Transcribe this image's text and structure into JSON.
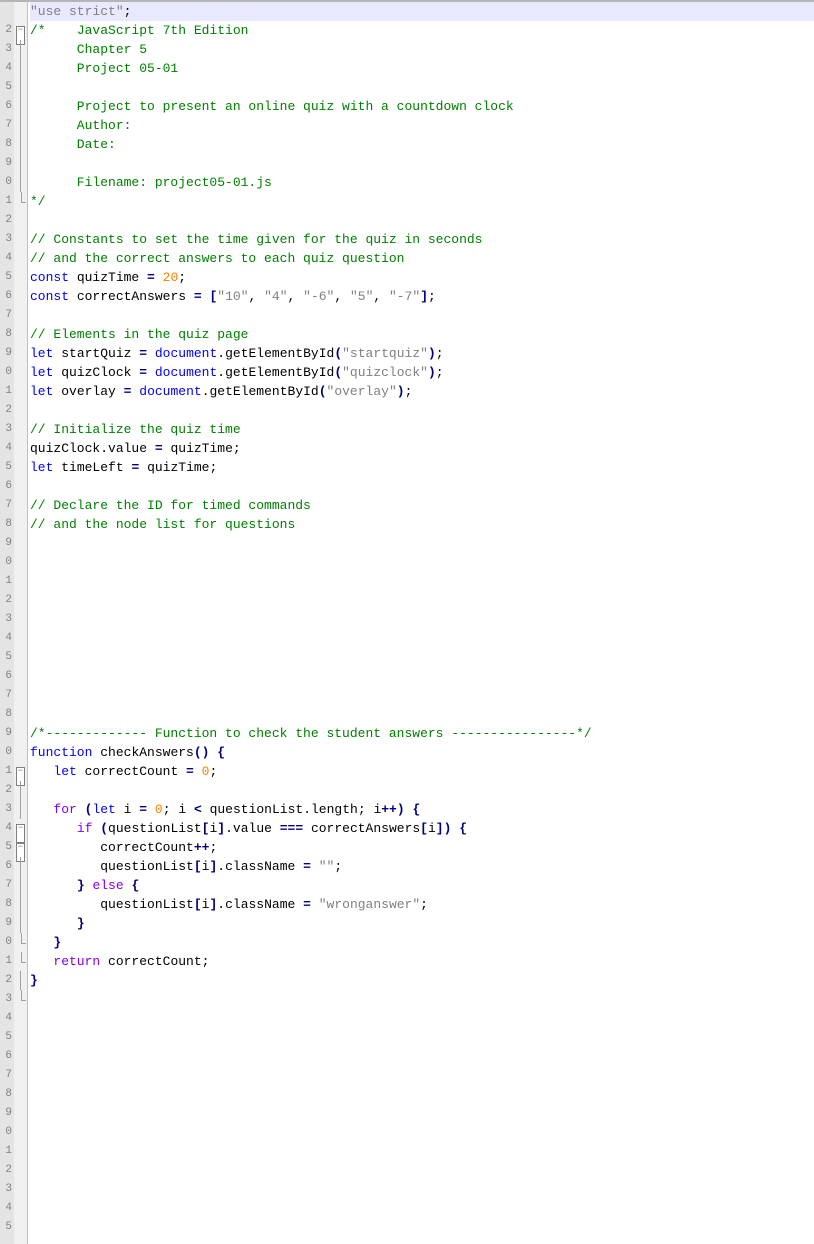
{
  "lineNumbers": [
    "",
    "2",
    "3",
    "4",
    "5",
    "6",
    "7",
    "8",
    "9",
    "0",
    "1",
    "2",
    "3",
    "4",
    "5",
    "6",
    "7",
    "8",
    "9",
    "0",
    "1",
    "2",
    "3",
    "4",
    "5",
    "6",
    "7",
    "8",
    "9",
    "0",
    "1",
    "2",
    "3",
    "4",
    "5",
    "6",
    "7",
    "8",
    "9",
    "0",
    "1",
    "2",
    "3",
    "4",
    "5",
    "6",
    "7",
    "8",
    "9",
    "0",
    "1",
    "2",
    "3",
    "4",
    "5",
    "6",
    "7",
    "8",
    "9",
    "0",
    "1",
    "2",
    "3",
    "4",
    "5"
  ],
  "fold": {
    "boxMinus": "−",
    "blockStart": 1,
    "blockEnd": 10,
    "funcStart": 40,
    "forStart": 43,
    "ifStart": 44,
    "funcEnd": 52
  },
  "code": {
    "l1": {
      "t": "\"use strict\"",
      "s": ";"
    },
    "l2a": "/*",
    "l2b": "    JavaScript 7th Edition",
    "l3": "      Chapter 5",
    "l4": "      Project 05-01",
    "l5": "",
    "l6": "      Project to present an online quiz with a countdown clock",
    "l7": "      Author:",
    "l8": "      Date:",
    "l9": "",
    "l10": "      Filename: project05-01.js",
    "l11": "*/",
    "l12": "",
    "l13": "// Constants to set the time given for the quiz in seconds",
    "l14": "// and the correct answers to each quiz question",
    "l15": {
      "kw": "const",
      "sp": " ",
      "id": "quizTime ",
      "op": "=",
      "sp2": " ",
      "num": "20",
      "semi": ";"
    },
    "l16": {
      "kw": "const",
      "sp": " ",
      "id": "correctAnswers ",
      "op": "=",
      "sp2": " ",
      "br": "[",
      "s1": "\"10\"",
      "c": ", ",
      "s2": "\"4\"",
      "c2": ", ",
      "s3": "\"-6\"",
      "c3": ", ",
      "s4": "\"5\"",
      "c4": ", ",
      "s5": "\"-7\"",
      "br2": "]",
      "semi": ";"
    },
    "l17": "",
    "l18": "// Elements in the quiz page",
    "l19": {
      "kw": "let",
      "sp": " ",
      "id": "startQuiz ",
      "op": "=",
      "sp2": " ",
      "obj": "document",
      "dot": ".",
      "fn": "getElementById",
      "p": "(",
      "s": "\"startquiz\"",
      "p2": ")",
      "semi": ";"
    },
    "l20": {
      "kw": "let",
      "sp": " ",
      "id": "quizClock ",
      "op": "=",
      "sp2": " ",
      "obj": "document",
      "dot": ".",
      "fn": "getElementById",
      "p": "(",
      "s": "\"quizclock\"",
      "p2": ")",
      "semi": ";"
    },
    "l21": {
      "kw": "let",
      "sp": " ",
      "id": "overlay ",
      "op": "=",
      "sp2": " ",
      "obj": "document",
      "dot": ".",
      "fn": "getElementById",
      "p": "(",
      "s": "\"overlay\"",
      "p2": ")",
      "semi": ";"
    },
    "l22": "",
    "l23": "// Initialize the quiz time",
    "l24": {
      "a": "quizClock",
      "d": ".",
      "b": "value ",
      "op": "=",
      "sp": " ",
      "c": "quizTime",
      "semi": ";"
    },
    "l25": {
      "kw": "let",
      "sp": " ",
      "id": "timeLeft ",
      "op": "=",
      "sp2": " ",
      "c": "quizTime",
      "semi": ";"
    },
    "l26": "",
    "l27": "// Declare the ID for timed commands",
    "l28": "// and the node list for questions",
    "blanks29to38": "",
    "l39": "/*------------- Function to check the student answers ----------------*/",
    "l40": {
      "kw": "function",
      "sp": " ",
      "fn": "checkAnswers",
      "p": "()",
      "sp2": " ",
      "br": "{"
    },
    "l41": {
      "ind": "   ",
      "kw": "let",
      "sp": " ",
      "id": "correctCount ",
      "op": "=",
      "sp2": " ",
      "num": "0",
      "semi": ";"
    },
    "l42": "",
    "l43": {
      "ind": "   ",
      "kw": "for",
      "sp": " ",
      "p": "(",
      "kw2": "let",
      "sp2": " ",
      "id": "i ",
      "op": "=",
      "sp3": " ",
      "num": "0",
      "semi": ";",
      "sp4": " ",
      "id2": "i ",
      "op2": "<",
      "sp5": " ",
      "id3": "questionList",
      "d": ".",
      "pr": "length",
      "semi2": ";",
      "sp6": " ",
      "id4": "i",
      "op3": "++",
      "p2": ")",
      "sp7": " ",
      "br": "{"
    },
    "l44": {
      "ind": "      ",
      "kw": "if",
      "sp": " ",
      "p": "(",
      "id": "questionList",
      "b": "[",
      "id2": "i",
      "b2": "]",
      "d": ".",
      "pr": "value ",
      "op": "===",
      "sp2": " ",
      "id3": "correctAnswers",
      "b3": "[",
      "id4": "i",
      "b4": "]",
      "p2": ")",
      "sp3": " ",
      "br": "{"
    },
    "l45": {
      "ind": "         ",
      "id": "correctCount",
      "op": "++",
      "semi": ";"
    },
    "l46": {
      "ind": "         ",
      "id": "questionList",
      "b": "[",
      "id2": "i",
      "b2": "]",
      "d": ".",
      "pr": "className ",
      "op": "=",
      "sp": " ",
      "s": "\"\"",
      "semi": ";"
    },
    "l47": {
      "ind": "      ",
      "br": "}",
      "sp": " ",
      "kw": "else",
      "sp2": " ",
      "br2": "{"
    },
    "l48": {
      "ind": "         ",
      "id": "questionList",
      "b": "[",
      "id2": "i",
      "b2": "]",
      "d": ".",
      "pr": "className ",
      "op": "=",
      "sp": " ",
      "s": "\"wronganswer\"",
      "semi": ";"
    },
    "l49": {
      "ind": "      ",
      "br": "}"
    },
    "l50": {
      "ind": "   ",
      "br": "}"
    },
    "l51": {
      "ind": "   ",
      "kw": "return",
      "sp": " ",
      "id": "correctCount",
      "semi": ";"
    },
    "l52": {
      "br": "}"
    }
  }
}
